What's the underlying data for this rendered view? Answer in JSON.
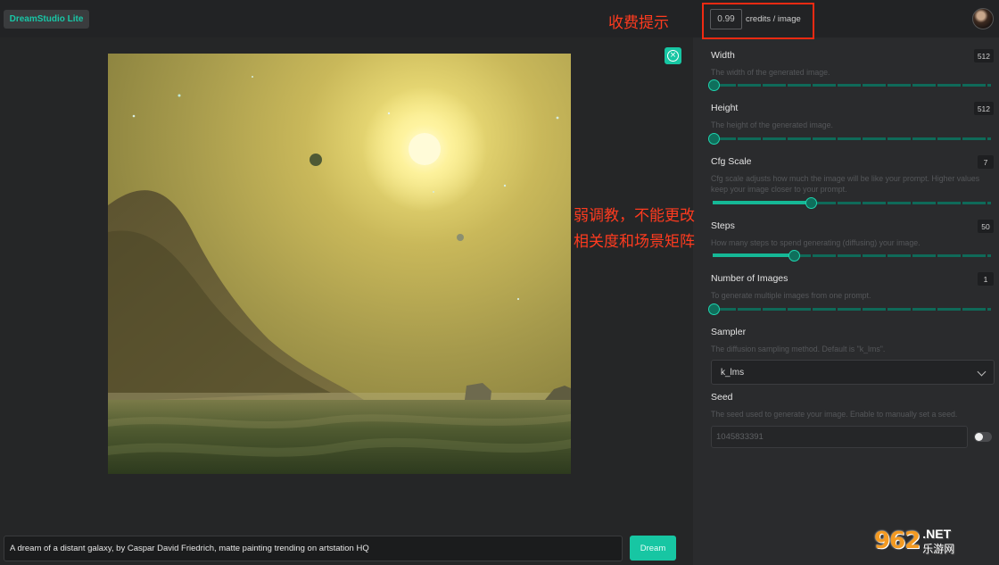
{
  "app": {
    "logo_label": "DreamStudio Lite"
  },
  "pricing": {
    "credits_value": "0.99",
    "credits_label": "credits / image"
  },
  "annotations": {
    "fee_hint": "收费提示",
    "tuning_line1": "弱调教，不能更改",
    "tuning_line2": "相关度和场景矩阵"
  },
  "prompt": {
    "text": "A dream of a distant galaxy, by Caspar David Friedrich, matte painting trending on artstation HQ",
    "dream_label": "Dream"
  },
  "settings": {
    "width": {
      "title": "Width",
      "desc": "The width of the generated image.",
      "value": "512",
      "level": 0.0
    },
    "height": {
      "title": "Height",
      "desc": "The height of the generated image.",
      "value": "512",
      "level": 0.0
    },
    "cfg": {
      "title": "Cfg Scale",
      "desc": "Cfg scale adjusts how much the image will be like your prompt. Higher values keep your image closer to your prompt.",
      "value": "7",
      "level": 0.35
    },
    "steps": {
      "title": "Steps",
      "desc": "How many steps to spend generating (diffusing) your image.",
      "value": "50",
      "level": 0.29
    },
    "num_images": {
      "title": "Number of Images",
      "desc": "To generate multiple images from one prompt.",
      "value": "1",
      "level": 0.0
    },
    "sampler": {
      "title": "Sampler",
      "desc": "The diffusion sampling method. Default is \"k_lms\".",
      "value": "k_lms"
    },
    "seed": {
      "title": "Seed",
      "desc": "The seed used to generate your image. Enable to manually set a seed.",
      "value": "1045833391"
    }
  },
  "watermark": {
    "logo": "962",
    "net": ".NET",
    "cn": "乐游网"
  },
  "colors": {
    "accent": "#17c6a3",
    "annotation": "#ff3b1f"
  }
}
